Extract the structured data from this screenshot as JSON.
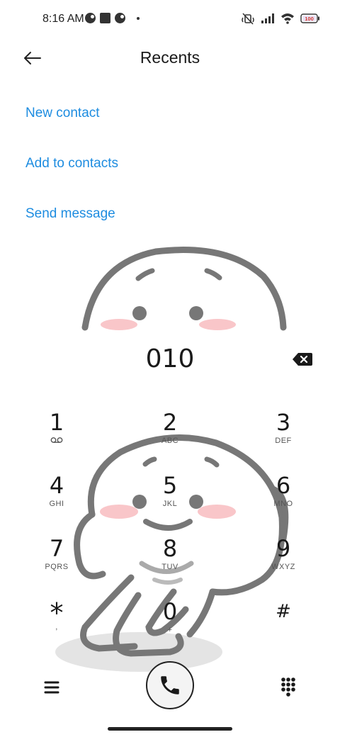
{
  "status_bar": {
    "time": "8:16 AM",
    "battery": "100"
  },
  "header": {
    "title": "Recents",
    "back_icon": "arrow-left-icon"
  },
  "actions": [
    {
      "label": "New contact"
    },
    {
      "label": "Add to contacts"
    },
    {
      "label": "Send message"
    }
  ],
  "dialer": {
    "number": "010",
    "backspace_icon": "backspace-icon"
  },
  "keys": [
    {
      "digit": "1",
      "sub": ""
    },
    {
      "digit": "2",
      "sub": "ABC"
    },
    {
      "digit": "3",
      "sub": "DEF"
    },
    {
      "digit": "4",
      "sub": "GHI"
    },
    {
      "digit": "5",
      "sub": "JKL"
    },
    {
      "digit": "6",
      "sub": "MNO"
    },
    {
      "digit": "7",
      "sub": "PQRS"
    },
    {
      "digit": "8",
      "sub": "TUV"
    },
    {
      "digit": "9",
      "sub": "WXYZ"
    },
    {
      "digit": "*",
      "sub": ","
    },
    {
      "digit": "0",
      "sub": "+"
    },
    {
      "digit": "#",
      "sub": ""
    }
  ],
  "bottom_bar": {
    "menu_icon": "menu-icon",
    "call_icon": "phone-icon",
    "keypad_icon": "dialpad-icon"
  },
  "colors": {
    "accent": "#1d8ce0",
    "text": "#1a1a1a"
  }
}
